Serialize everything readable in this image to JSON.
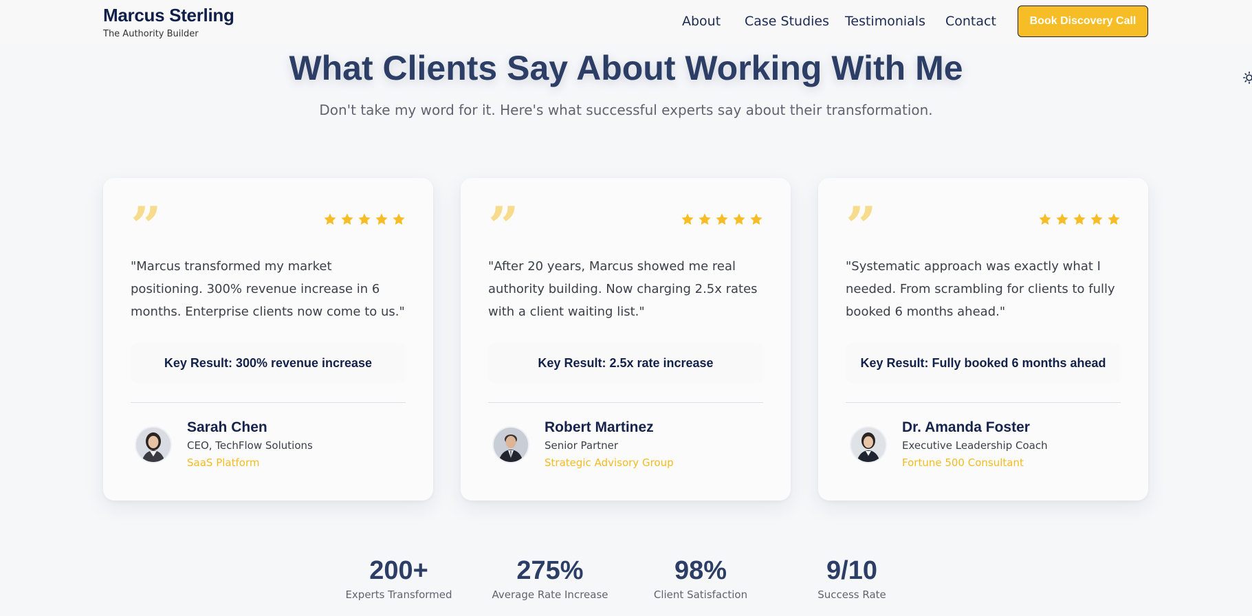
{
  "header": {
    "brand_name": "Marcus Sterling",
    "brand_tagline": "The Authority Builder",
    "nav": [
      "About",
      "Case Studies",
      "Testimonials",
      "Contact"
    ],
    "cta_label": "Book Discovery Call"
  },
  "hero": {
    "title": "What Clients Say About Working With Me",
    "subtitle": "Don't take my word for it. Here's what successful experts say about their transformation."
  },
  "testimonials": [
    {
      "rating": 5,
      "quote": "\"Marcus transformed my market positioning. 300% revenue increase in 6 months. Enterprise clients now come to us.\"",
      "key_result": "Key Result: 300% revenue increase",
      "name": "Sarah Chen",
      "role": "CEO, TechFlow Solutions",
      "company": "SaaS Platform"
    },
    {
      "rating": 5,
      "quote": "\"After 20 years, Marcus showed me real authority building. Now charging 2.5x rates with a client waiting list.\"",
      "key_result": "Key Result: 2.5x rate increase",
      "name": "Robert Martinez",
      "role": "Senior Partner",
      "company": "Strategic Advisory Group"
    },
    {
      "rating": 5,
      "quote": "\"Systematic approach was exactly what I needed. From scrambling for clients to fully booked 6 months ahead.\"",
      "key_result": "Key Result: Fully booked 6 months ahead",
      "name": "Dr. Amanda Foster",
      "role": "Executive Leadership Coach",
      "company": "Fortune 500 Consultant"
    }
  ],
  "stats": [
    {
      "value": "200+",
      "label": "Experts Transformed"
    },
    {
      "value": "275%",
      "label": "Average Rate Increase"
    },
    {
      "value": "98%",
      "label": "Client Satisfaction"
    },
    {
      "value": "9/10",
      "label": "Success Rate"
    }
  ],
  "colors": {
    "accent": "#f6bd26",
    "navy": "#1b2a4a",
    "heading": "#2c3e66"
  },
  "icons": {
    "quote": "quote-icon",
    "star": "star-icon",
    "theme": "sun-icon"
  }
}
